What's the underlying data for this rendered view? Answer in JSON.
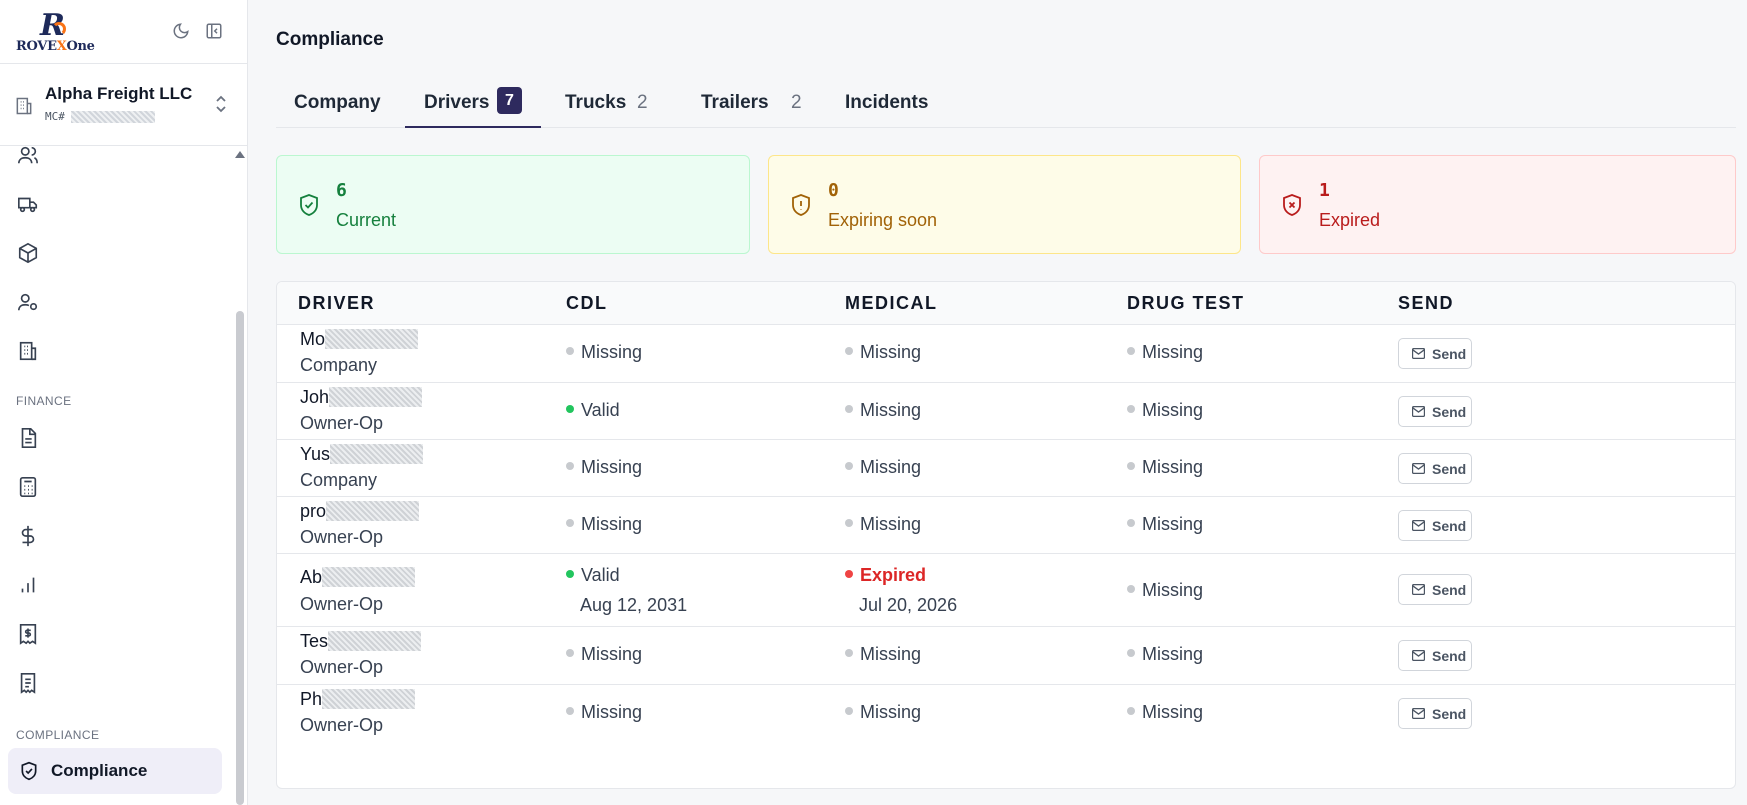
{
  "brand": {
    "wordmark_a": "ROVE",
    "wordmark_x": "X",
    "wordmark_b": "One"
  },
  "sidebar": {
    "company_name": "Alpha Freight LLC",
    "mc_label": "MC#",
    "section_finance": "FINANCE",
    "section_compliance": "COMPLIANCE",
    "active_item": "Compliance",
    "nav_icons": [
      "users-icon",
      "truck-icon",
      "box-icon",
      "user-settings-icon",
      "building-icon",
      "file-text-icon",
      "calculator-icon",
      "dollar-icon",
      "bar-chart-icon",
      "invoice-dollar-icon",
      "receipt-icon"
    ]
  },
  "page": {
    "title": "Compliance"
  },
  "tabs": [
    {
      "label": "Company",
      "count": ""
    },
    {
      "label": "Drivers",
      "count": "7"
    },
    {
      "label": "Trucks",
      "count": "2"
    },
    {
      "label": "Trailers",
      "count": "2"
    },
    {
      "label": "Incidents",
      "count": ""
    }
  ],
  "summary": {
    "current": {
      "value": "6",
      "label": "Current"
    },
    "expiring": {
      "value": "0",
      "label": "Expiring soon"
    },
    "expired": {
      "value": "1",
      "label": "Expired"
    }
  },
  "table": {
    "headers": [
      "DRIVER",
      "CDL",
      "MEDICAL",
      "DRUG TEST",
      "SEND"
    ],
    "send_label": "Send",
    "rows": [
      {
        "name": "Mo",
        "type": "Company",
        "cdl": "Missing",
        "cdl_date": "",
        "medical": "Missing",
        "medical_date": "",
        "drug": "Missing"
      },
      {
        "name": "Joh",
        "type": "Owner-Op",
        "cdl": "Valid",
        "cdl_date": "",
        "medical": "Missing",
        "medical_date": "",
        "drug": "Missing"
      },
      {
        "name": "Yus",
        "type": "Company",
        "cdl": "Missing",
        "cdl_date": "",
        "medical": "Missing",
        "medical_date": "",
        "drug": "Missing"
      },
      {
        "name": "pro",
        "type": "Owner-Op",
        "cdl": "Missing",
        "cdl_date": "",
        "medical": "Missing",
        "medical_date": "",
        "drug": "Missing"
      },
      {
        "name": "Ab",
        "type": "Owner-Op",
        "cdl": "Valid",
        "cdl_date": "Aug 12, 2031",
        "medical": "Expired",
        "medical_date": "Jul 20, 2026",
        "drug": "Missing"
      },
      {
        "name": "Tes",
        "type": "Owner-Op",
        "cdl": "Missing",
        "cdl_date": "",
        "medical": "Missing",
        "medical_date": "",
        "drug": "Missing"
      },
      {
        "name": "Ph",
        "type": "Owner-Op",
        "cdl": "Missing",
        "cdl_date": "",
        "medical": "Missing",
        "medical_date": "",
        "drug": "Missing"
      }
    ]
  },
  "colors": {
    "accent": "#2e2a5e",
    "valid": "#22c55e",
    "expired": "#ef4444",
    "missing": "#c7cace"
  }
}
